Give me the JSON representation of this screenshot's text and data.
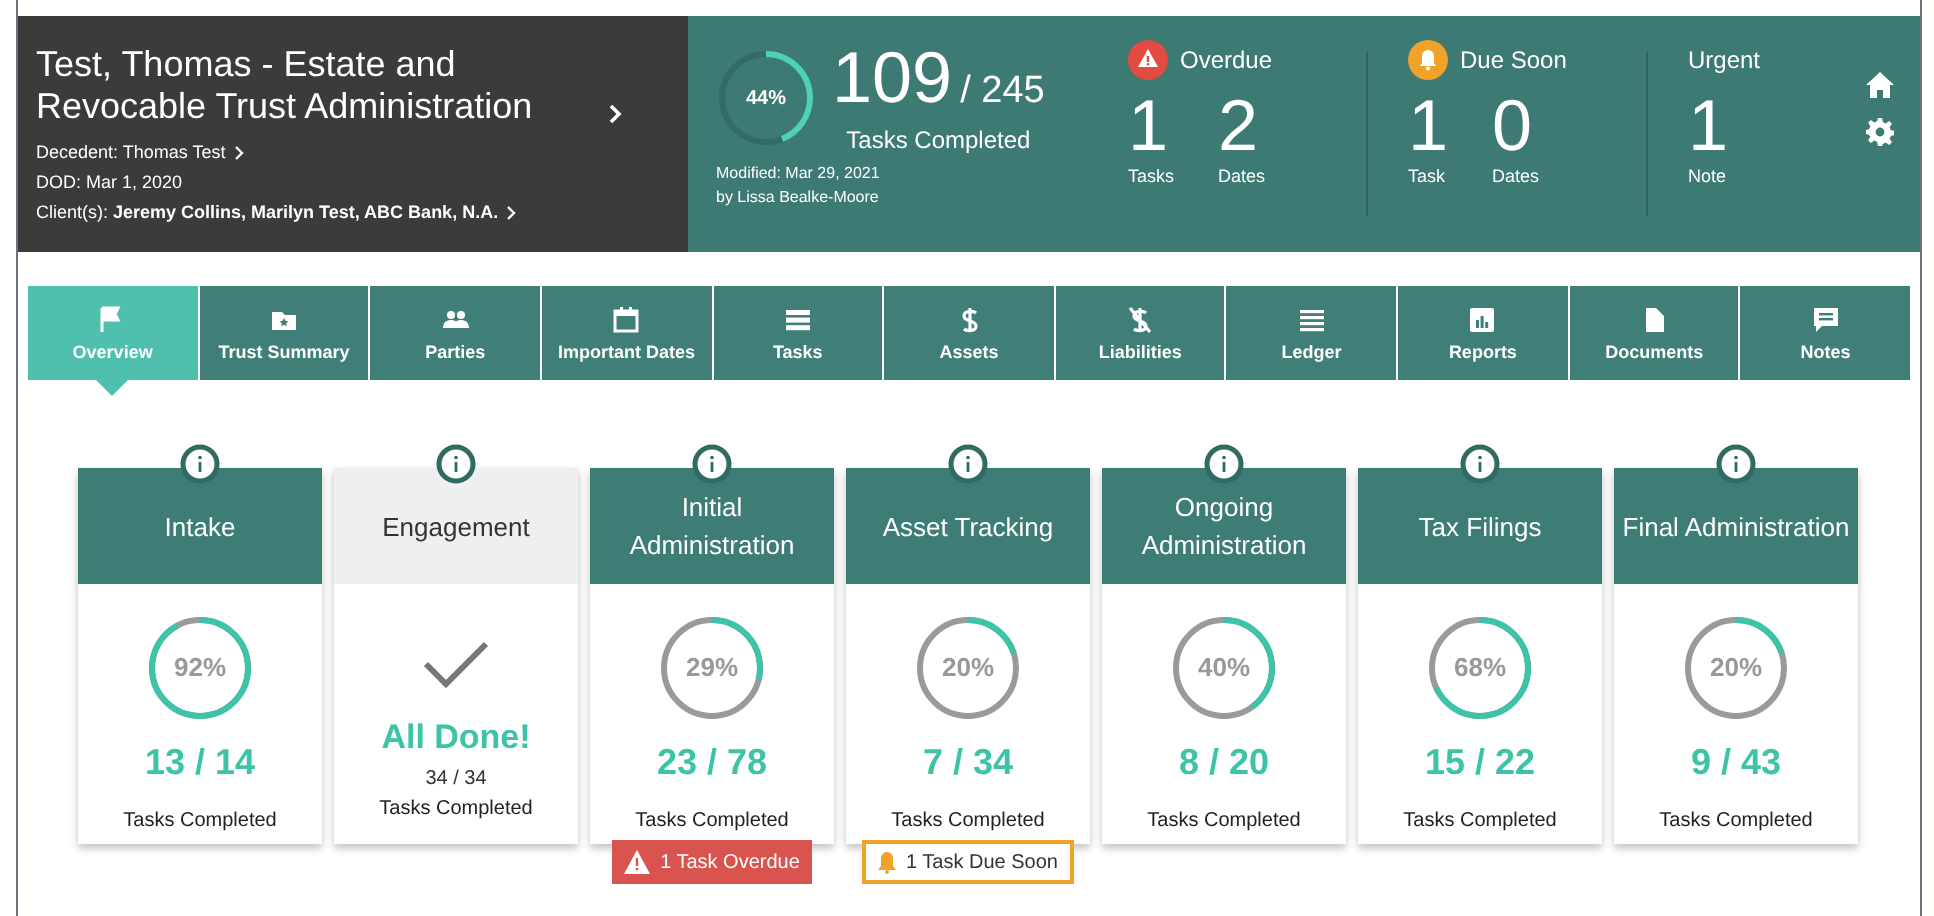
{
  "case": {
    "title": "Test, Thomas - Estate and Revocable Trust Administration",
    "decedent": "Decedent: Thomas Test",
    "dod": "DOD: Mar 1, 2020",
    "clients": "Client(s): **Jeremy Collins, Marilyn Test, ABC Bank, N.A.**"
  },
  "progress": {
    "percent": "44%",
    "level": 0.44,
    "done": "109",
    "total": "/ 245",
    "label": "Tasks Completed",
    "modified": "Modified: Mar 29, 2021",
    "by": "by Lissa Bealke-Moore"
  },
  "alert_groups": [
    {
      "kind": "overdue",
      "title": "Overdue",
      "counts": [
        {
          "value": "1",
          "label": "Tasks"
        },
        {
          "value": "2",
          "label": "Dates"
        }
      ]
    },
    {
      "kind": "due_soon",
      "title": "Due Soon",
      "counts": [
        {
          "value": "1",
          "label": "Task"
        },
        {
          "value": "0",
          "label": "Dates"
        }
      ]
    },
    {
      "kind": "urgent",
      "title": "Urgent",
      "counts": [
        {
          "value": "1",
          "label": "Note"
        }
      ]
    }
  ],
  "tabs": [
    {
      "label": "Overview",
      "selected": true
    },
    {
      "label": "Trust Summary",
      "selected": false
    },
    {
      "label": "Parties",
      "selected": false
    },
    {
      "label": "Important Dates",
      "selected": false
    },
    {
      "label": "Tasks",
      "selected": false
    },
    {
      "label": "Assets",
      "selected": false
    },
    {
      "label": "Liabilities",
      "selected": false
    },
    {
      "label": "Ledger",
      "selected": false
    },
    {
      "label": "Reports",
      "selected": false
    },
    {
      "label": "Documents",
      "selected": false
    },
    {
      "label": "Notes",
      "selected": false
    }
  ],
  "stages": [
    {
      "kind": "progress",
      "title": "Intake",
      "percent": "92%",
      "level": 0.92,
      "count": "13 / 14",
      "label": "Tasks Completed"
    },
    {
      "kind": "done",
      "title": "Engagement",
      "done_text": "All Done!",
      "count": "34 / 34",
      "label": "Tasks Completed"
    },
    {
      "kind": "progress",
      "title": "Initial Administration",
      "percent": "29%",
      "level": 0.29,
      "count": "23 / 78",
      "label": "Tasks Completed",
      "alert": {
        "kind": "overdue",
        "text": "1 Task Overdue"
      }
    },
    {
      "kind": "progress",
      "title": "Asset Tracking",
      "percent": "20%",
      "level": 0.2,
      "count": "7 / 34",
      "label": "Tasks Completed",
      "alert": {
        "kind": "due_soon",
        "text": "1 Task Due Soon"
      }
    },
    {
      "kind": "progress",
      "title": "Ongoing Administration",
      "percent": "40%",
      "level": 0.4,
      "count": "8 / 20",
      "label": "Tasks Completed"
    },
    {
      "kind": "progress",
      "title": "Tax Filings",
      "percent": "68%",
      "level": 0.68,
      "count": "15 / 22",
      "label": "Tasks Completed"
    },
    {
      "kind": "progress",
      "title": "Final Administration",
      "percent": "20%",
      "level": 0.2,
      "count": "9 / 43",
      "label": "Tasks Completed"
    }
  ]
}
